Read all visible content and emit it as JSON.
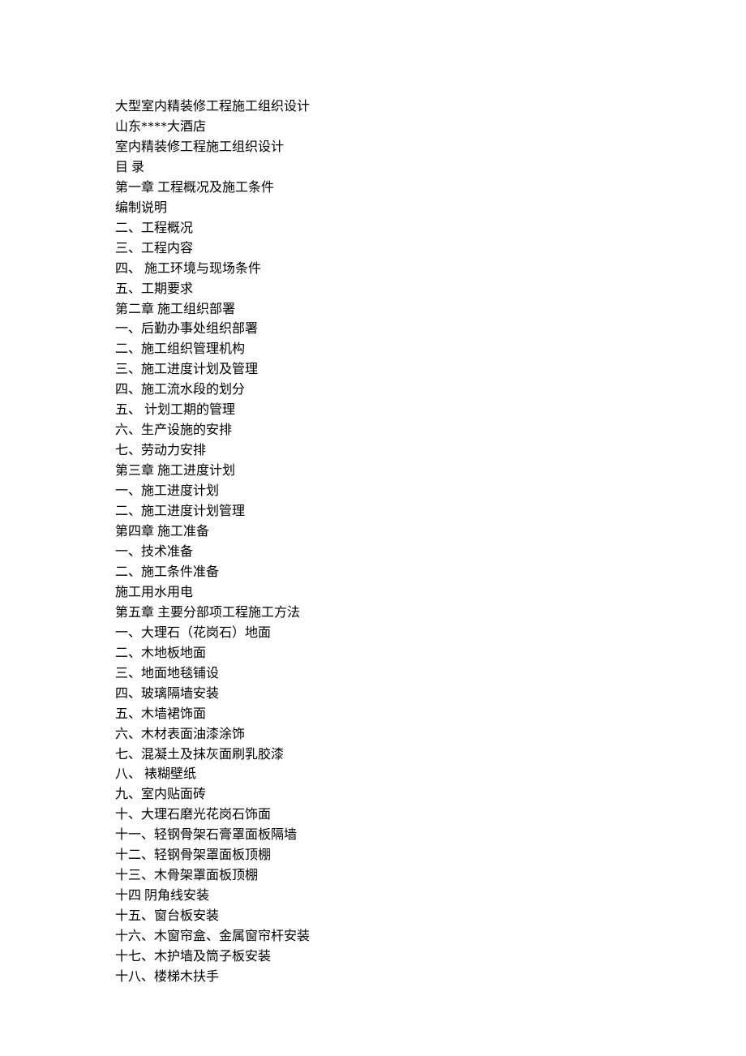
{
  "lines": [
    "大型室内精装修工程施工组织设计",
    "山东****大酒店",
    "室内精装修工程施工组织设计",
    "目  录",
    "第一章  工程概况及施工条件",
    "编制说明",
    "二、工程概况",
    "三、工程内容",
    "四、 施工环境与现场条件",
    "五、工期要求",
    "第二章  施工组织部署",
    "一、后勤办事处组织部署",
    "二、施工组织管理机构",
    "三、施工进度计划及管理",
    "四、施工流水段的划分",
    "五、 计划工期的管理",
    "六、生产设施的安排",
    "七、劳动力安排",
    "第三章  施工进度计划",
    "一、施工进度计划",
    "二、施工进度计划管理",
    "第四章  施工准备",
    "一、技术准备",
    "二、施工条件准备",
    "施工用水用电",
    "第五章  主要分部项工程施工方法",
    "一、大理石（花岗石）地面",
    "二、木地板地面",
    "三、地面地毯铺设",
    "四、玻璃隔墙安装",
    "五、木墙裙饰面",
    "六、木材表面油漆涂饰",
    "七、混凝土及抹灰面刷乳胶漆",
    "八、 裱糊壁纸",
    "九、室内贴面砖",
    "十、大理石磨光花岗石饰面",
    "十一、轻钢骨架石膏罩面板隔墙",
    "十二、轻钢骨架罩面板顶棚",
    "十三、木骨架罩面板顶棚",
    "十四  阴角线安装",
    "十五、窗台板安装",
    "十六、木窗帘盒、金属窗帘杆安装",
    "十七、木护墙及筒子板安装",
    "十八、楼梯木扶手"
  ]
}
